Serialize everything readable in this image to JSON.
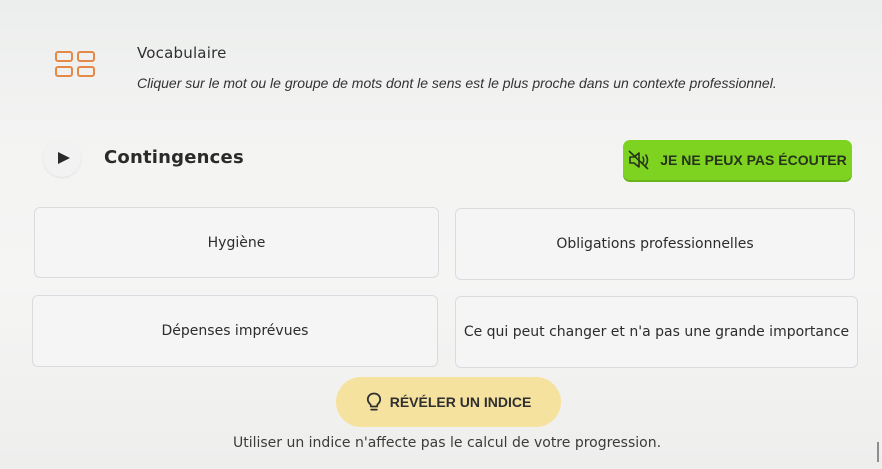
{
  "header": {
    "icon": "grid-icon",
    "title": "Vocabulaire",
    "instruction": "Cliquer sur le mot ou le groupe de mots dont le sens est le plus proche dans un contexte professionnel."
  },
  "prompt": {
    "play_icon": "play-icon",
    "word": "Contingences",
    "cant_listen_label": "JE NE PEUX PAS ÉCOUTER",
    "cant_listen_icon": "speaker-muted-icon"
  },
  "options": [
    "Hygiène",
    "Obligations professionnelles",
    "Dépenses imprévues",
    "Ce qui peut changer et n'a pas une grande importance"
  ],
  "hint": {
    "icon": "lightbulb-icon",
    "label": "RÉVÉLER UN INDICE",
    "note": "Utiliser un indice n'affecte pas le calcul de votre progression."
  },
  "colors": {
    "accent_orange": "#e48a46",
    "cant_listen_green": "#7ed321",
    "hint_yellow": "#f6e29f"
  }
}
